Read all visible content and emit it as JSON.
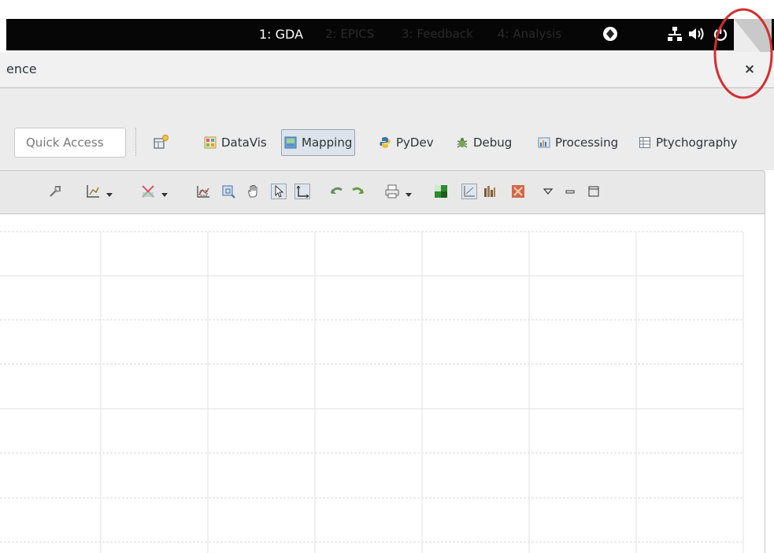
{
  "topbar": {
    "workspaces": [
      {
        "label": "1: GDA",
        "active": true
      },
      {
        "label": "2: EPICS",
        "active": false
      },
      {
        "label": "3: Feedback",
        "active": false
      },
      {
        "label": "4: Analysis",
        "active": false
      }
    ],
    "tray_icons": [
      "weather-icon",
      "network-icon",
      "volume-icon",
      "power-icon"
    ]
  },
  "window": {
    "title": "ence",
    "close_label": "×"
  },
  "perspective_bar": {
    "quick_access_placeholder": "Quick Access",
    "perspectives": [
      {
        "label": "DataVis",
        "active": false
      },
      {
        "label": "Mapping",
        "active": true
      },
      {
        "label": "PyDev",
        "active": false
      },
      {
        "label": "Debug",
        "active": false
      },
      {
        "label": "Processing",
        "active": false
      },
      {
        "label": "Ptychography",
        "active": false
      }
    ]
  },
  "view_toolbar": {
    "icons": [
      "configure-icon",
      "axis-settings-icon",
      "clear-plot-icon",
      "zoom-area-icon",
      "zoom-box-icon",
      "pan-icon",
      "pointer-icon",
      "origin-axis-icon",
      "undo-zoom-icon",
      "redo-zoom-icon",
      "print-icon",
      "colour-map-icon",
      "plot-type-icon",
      "histogram-icon",
      "region-icon",
      "view-menu-icon",
      "minimize-icon",
      "maximize-icon"
    ]
  },
  "colors": {
    "annotation": "#d32f2f",
    "grid_line": "#d9d9d9",
    "mapping_active_bg": "#dde3ea"
  }
}
